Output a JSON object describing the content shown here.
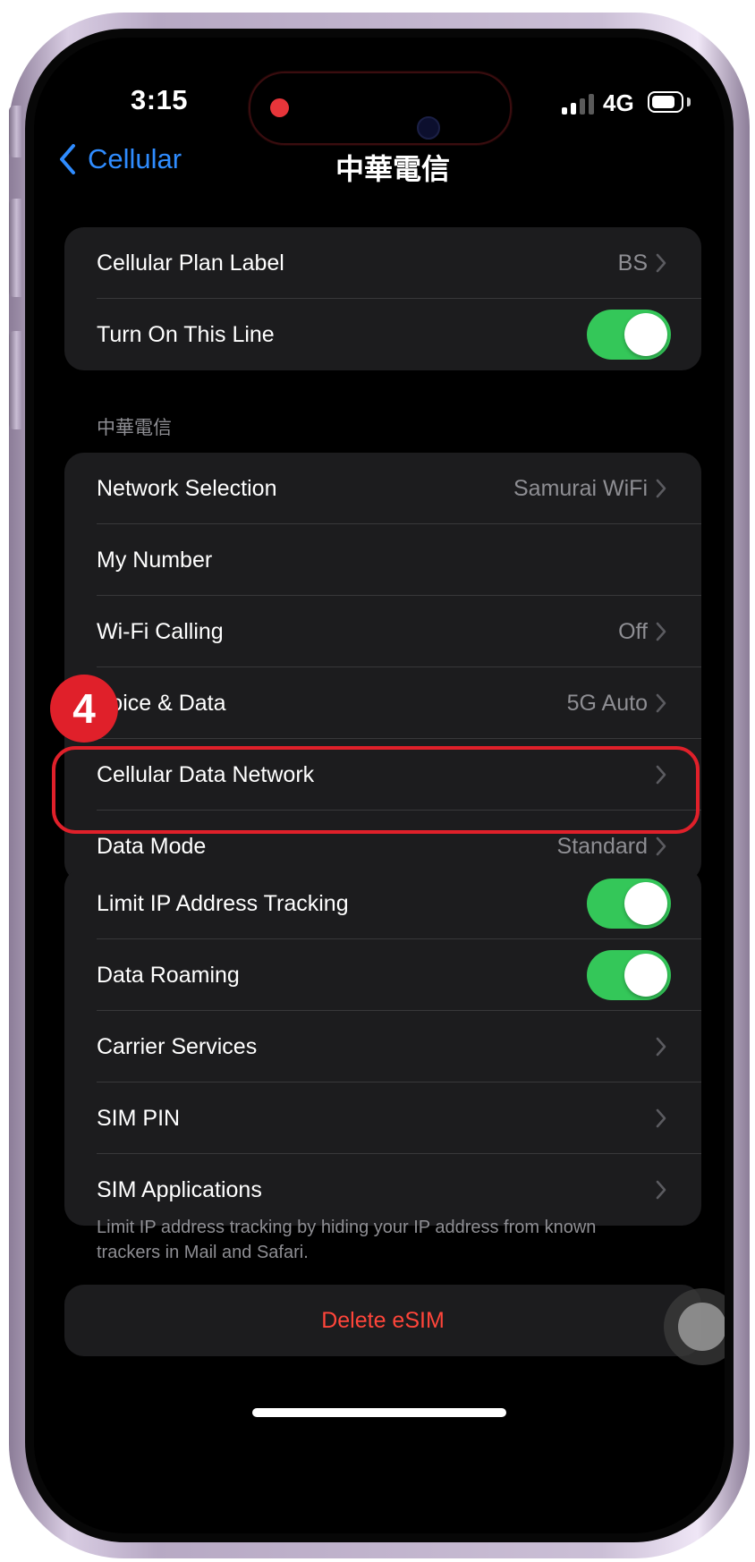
{
  "status_bar": {
    "time": "3:15",
    "network": "4G"
  },
  "nav": {
    "back_label": "Cellular",
    "title": "中華電信"
  },
  "group1": [
    {
      "label": "Cellular Plan Label",
      "value": "BS",
      "chevron": true
    },
    {
      "label": "Turn On This Line",
      "toggle": "on"
    }
  ],
  "section_header": "中華電信",
  "group2": [
    {
      "label": "Network Selection",
      "value": "Samurai WiFi",
      "chevron": true
    },
    {
      "label": "My Number"
    },
    {
      "label": "Wi-Fi Calling",
      "value": "Off",
      "chevron": true
    },
    {
      "label": "Voice & Data",
      "value": "5G Auto",
      "chevron": true
    },
    {
      "label": "Cellular Data Network",
      "chevron": true
    },
    {
      "label": "Data Mode",
      "value": "Standard",
      "chevron": true
    }
  ],
  "group3": [
    {
      "label": "Limit IP Address Tracking",
      "toggle": "on"
    },
    {
      "label": "Data Roaming",
      "toggle": "on"
    },
    {
      "label": "Carrier Services",
      "chevron": true
    },
    {
      "label": "SIM PIN",
      "chevron": true
    },
    {
      "label": "SIM Applications",
      "chevron": true
    }
  ],
  "footer_note": "Limit IP address tracking by hiding your IP address from known trackers in Mail and Safari.",
  "delete_label": "Delete eSIM",
  "step_badge": "4",
  "colors": {
    "accent_blue": "#2f8cff",
    "toggle_green": "#34c759",
    "destructive_red": "#ff453a",
    "highlight_red": "#e0202a"
  }
}
